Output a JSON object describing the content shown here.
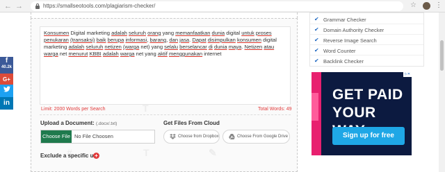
{
  "browser": {
    "url": "https://smallseotools.com/plagiarism-checker/",
    "back_glyph": "←",
    "forward_glyph": "→",
    "menu_glyph": "⋮",
    "star_glyph": "☆"
  },
  "social": {
    "facebook": {
      "icon": "f",
      "count": "40.2k"
    },
    "googleplus": {
      "icon": "G+"
    },
    "twitter": {
      "icon": "🐦"
    },
    "linkedin": {
      "icon": "in"
    }
  },
  "editor": {
    "segments": [
      {
        "t": "Konsumen",
        "err": true
      },
      {
        "t": " Digital marketing ",
        "err": false
      },
      {
        "t": "adalah",
        "err": true
      },
      {
        "t": " ",
        "err": false
      },
      {
        "t": "seluruh",
        "err": true
      },
      {
        "t": " ",
        "err": false
      },
      {
        "t": "orang",
        "err": true
      },
      {
        "t": " yang ",
        "err": false
      },
      {
        "t": "memanfaatkan",
        "err": true
      },
      {
        "t": " ",
        "err": false
      },
      {
        "t": "dunia",
        "err": true
      },
      {
        "t": " digital ",
        "err": false
      },
      {
        "t": "untuk",
        "err": true
      },
      {
        "t": " ",
        "err": false
      },
      {
        "t": "proses",
        "err": true
      },
      {
        "t": " ",
        "err": false
      },
      {
        "t": "penukaran",
        "err": true
      },
      {
        "t": " ",
        "err": false
      },
      {
        "t": "(transaksi)",
        "err": true
      },
      {
        "t": " ",
        "err": false
      },
      {
        "t": "baik",
        "err": true
      },
      {
        "t": " ",
        "err": false
      },
      {
        "t": "berupa",
        "err": true
      },
      {
        "t": " ",
        "err": false
      },
      {
        "t": "informasi",
        "err": true
      },
      {
        "t": ", ",
        "err": false
      },
      {
        "t": "barang",
        "err": true
      },
      {
        "t": ", ",
        "err": false
      },
      {
        "t": "dan",
        "err": true
      },
      {
        "t": " ",
        "err": false
      },
      {
        "t": "jasa",
        "err": true
      },
      {
        "t": ". ",
        "err": false
      },
      {
        "t": "Dapat",
        "err": true
      },
      {
        "t": " ",
        "err": false
      },
      {
        "t": "disimpulkan",
        "err": true
      },
      {
        "t": " ",
        "err": false
      },
      {
        "t": "konsumen",
        "err": true
      },
      {
        "t": " digital marketing ",
        "err": false
      },
      {
        "t": "adalah",
        "err": true
      },
      {
        "t": " ",
        "err": false
      },
      {
        "t": "seluruh",
        "err": true
      },
      {
        "t": " ",
        "err": false
      },
      {
        "t": "netizen",
        "err": true
      },
      {
        "t": " ",
        "err": false
      },
      {
        "t": "(warga",
        "err": true
      },
      {
        "t": " net) yang ",
        "err": false
      },
      {
        "t": "selalu",
        "err": true
      },
      {
        "t": " ",
        "err": false
      },
      {
        "t": "berselancar",
        "err": true
      },
      {
        "t": " ",
        "err": false
      },
      {
        "t": "di",
        "err": true
      },
      {
        "t": " ",
        "err": false
      },
      {
        "t": "dunia",
        "err": true
      },
      {
        "t": " ",
        "err": false
      },
      {
        "t": "maya",
        "err": true
      },
      {
        "t": ". ",
        "err": false
      },
      {
        "t": "Netizen",
        "err": true
      },
      {
        "t": " ",
        "err": false
      },
      {
        "t": "atau",
        "err": true
      },
      {
        "t": " ",
        "err": false
      },
      {
        "t": "warga",
        "err": true
      },
      {
        "t": " net ",
        "err": false
      },
      {
        "t": "menurut",
        "err": true
      },
      {
        "t": " ",
        "err": false
      },
      {
        "t": "KBBI",
        "err": true
      },
      {
        "t": " ",
        "err": false
      },
      {
        "t": "adalah",
        "err": true
      },
      {
        "t": " ",
        "err": false
      },
      {
        "t": "warga",
        "err": true
      },
      {
        "t": " net yang ",
        "err": false
      },
      {
        "t": "aktif",
        "err": true
      },
      {
        "t": " ",
        "err": false
      },
      {
        "t": "menggunakan",
        "err": true
      },
      {
        "t": " internet",
        "err": false
      }
    ],
    "limit_text": "Limit: 2000 Words per Search",
    "total_text": "Total Words: 49"
  },
  "upload": {
    "title": "Upload a Document:",
    "hint": "(.docx/.txt)",
    "choose_label": "Choose File",
    "file_placeholder": "No File Choosen"
  },
  "cloud": {
    "title": "Get Files From Cloud",
    "dropbox_label": "Choose from Dropbox",
    "gdrive_label": "Choose From Google Drive"
  },
  "exclude": {
    "label": "Exclude a specific url",
    "plus": "+"
  },
  "sidebar": {
    "items": [
      {
        "label": "Grammar Checker"
      },
      {
        "label": "Domain Authority Checker"
      },
      {
        "label": "Reverse Image Search"
      },
      {
        "label": "Word Counter"
      },
      {
        "label": "Backlink Checker"
      }
    ]
  },
  "ad": {
    "corner": "▷✕",
    "title": "GET PAID YOUR WAY",
    "button": "Sign up for free"
  },
  "colors": {
    "accent_green": "#1f7a4d",
    "error_red": "#e23b3b",
    "check_blue": "#1d67c1",
    "ad_bg": "#0c1a40",
    "ad_button": "#1fa7e6"
  }
}
